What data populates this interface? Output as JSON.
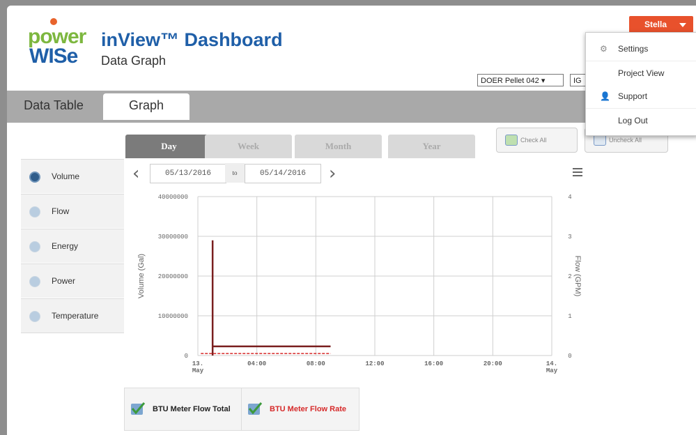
{
  "header": {
    "logo_top": "power",
    "logo_bottom": "WISe",
    "title": "inView™ Dashboard",
    "subtitle": "Data Graph",
    "project_select": "DOER Pellet 042 ▾",
    "project_select2": "IG"
  },
  "user_menu": {
    "name": "Stella",
    "items": [
      {
        "label": "Settings",
        "icon": "gear-icon"
      },
      {
        "label": "Project View",
        "icon": ""
      },
      {
        "label": "Support",
        "icon": "person-icon"
      },
      {
        "label": "Log Out",
        "icon": ""
      }
    ]
  },
  "tabs": [
    {
      "label": "Data Table"
    },
    {
      "label": "Graph"
    }
  ],
  "range_tabs": [
    "Day",
    "Week",
    "Month",
    "Year"
  ],
  "check_all": "Check All",
  "uncheck_all": "Uncheck All",
  "metrics": [
    {
      "label": "Volume",
      "active": true
    },
    {
      "label": "Flow",
      "active": false
    },
    {
      "label": "Energy",
      "active": false
    },
    {
      "label": "Power",
      "active": false
    },
    {
      "label": "Temperature",
      "active": false
    }
  ],
  "date_range": {
    "from": "05/13/2016",
    "to_label": "to",
    "to": "05/14/2016"
  },
  "colors": {
    "accent": "#e8512c",
    "brand_blue": "#1f5fa8",
    "series_volume": "#7a1f1f",
    "series_flow": "#d62a2a"
  },
  "chart_data": {
    "type": "line",
    "title": "",
    "ylabel": "Volume (Gal)",
    "y2label": "Flow (GPM)",
    "x_ticks": [
      "13. May",
      "04:00",
      "08:00",
      "12:00",
      "16:00",
      "20:00",
      "14. May"
    ],
    "y_ticks": [
      "40000000",
      "30000000",
      "20000000",
      "10000000",
      "0"
    ],
    "y2_ticks": [
      "4",
      "3",
      "2",
      "1",
      "0"
    ],
    "ylim": [
      0,
      40000000
    ],
    "y2lim": [
      0,
      4
    ],
    "grid": true,
    "series": [
      {
        "name": "BTU Meter Flow Total",
        "axis": "left",
        "color": "#7a1f1f",
        "x": [
          1.0,
          1.0,
          1.0,
          1.0,
          9.0
        ],
        "values": [
          0,
          29000000,
          22000000,
          2300000,
          2300000
        ]
      },
      {
        "name": "BTU Meter Flow Rate",
        "axis": "right",
        "color": "#d62a2a",
        "x": [
          0.2,
          9.0
        ],
        "values": [
          0.05,
          0.05
        ]
      }
    ]
  },
  "legend": [
    {
      "label": "BTU Meter Flow Total",
      "color": "#7a1f1f"
    },
    {
      "label": "BTU Meter Flow Rate",
      "color": "#d62a2a"
    }
  ]
}
